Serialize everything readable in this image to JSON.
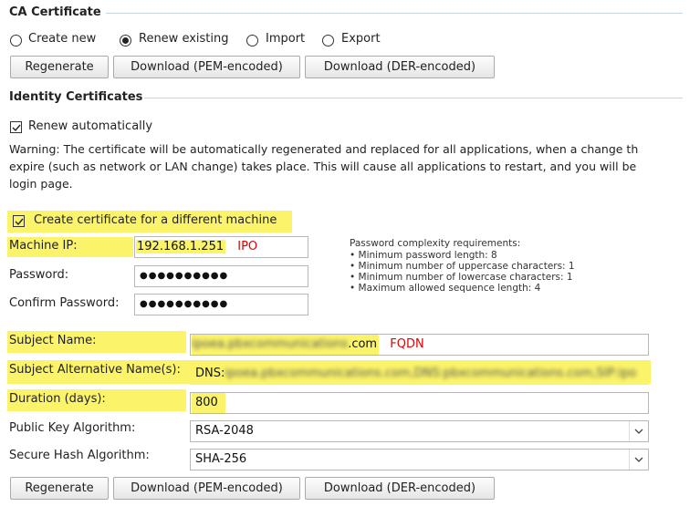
{
  "ca_section": {
    "title": "CA Certificate",
    "radios": [
      {
        "label": "Create new",
        "selected": false
      },
      {
        "label": "Renew existing",
        "selected": true
      },
      {
        "label": "Import",
        "selected": false
      },
      {
        "label": "Export",
        "selected": false
      }
    ],
    "buttons": {
      "regenerate": "Regenerate",
      "download_pem": "Download (PEM-encoded)",
      "download_der": "Download (DER-encoded)"
    }
  },
  "identity_section": {
    "title": "Identity Certificates",
    "renew_automatically": {
      "label": "Renew automatically",
      "checked": true
    },
    "warning_lines": [
      "Warning: The certificate will be automatically regenerated and replaced for all applications, when a change th",
      "expire (such as network or LAN change) takes place. This will cause all applications to restart, and you will be",
      "login page."
    ],
    "different_machine": {
      "label": "Create certificate for a different machine",
      "checked": true
    }
  },
  "form": {
    "machine_ip": {
      "label": "Machine IP:",
      "value": "192.168.1.251",
      "annotation": "IPO"
    },
    "password": {
      "label": "Password:",
      "value": "●●●●●●●●●●"
    },
    "confirm_password": {
      "label": "Confirm Password:",
      "value": "●●●●●●●●●●"
    },
    "password_requirements": {
      "title": "Password complexity requirements:",
      "items": [
        "• Minimum password length: 8",
        "• Minimum number of uppercase characters: 1",
        "• Minimum number of lowercase characters: 1",
        "• Maximum allowed sequence length: 4"
      ]
    },
    "subject_name": {
      "label": "Subject Name:",
      "value_obscured": "ipoea.pbxcommunications",
      "value_suffix": ".com",
      "annotation": "FQDN"
    },
    "subject_alt_name": {
      "label": "Subject Alternative Name(s):",
      "value_prefix": "DNS:",
      "value_obscured": "ipoea.pbxcommunications.com,DNS:pbxcommunications.com,SIP:ipo"
    },
    "duration": {
      "label": "Duration (days):",
      "value": "800"
    },
    "public_key_algorithm": {
      "label": "Public Key Algorithm:",
      "value": "RSA-2048"
    },
    "secure_hash_algorithm": {
      "label": "Secure Hash Algorithm:",
      "value": "SHA-256"
    }
  },
  "bottom_buttons": {
    "regenerate": "Regenerate",
    "download_pem": "Download (PEM-encoded)",
    "download_der": "Download (DER-encoded)"
  },
  "colors": {
    "highlight": "#fbf46a",
    "annotation": "#e00000",
    "rule": "#c8d4e0"
  }
}
